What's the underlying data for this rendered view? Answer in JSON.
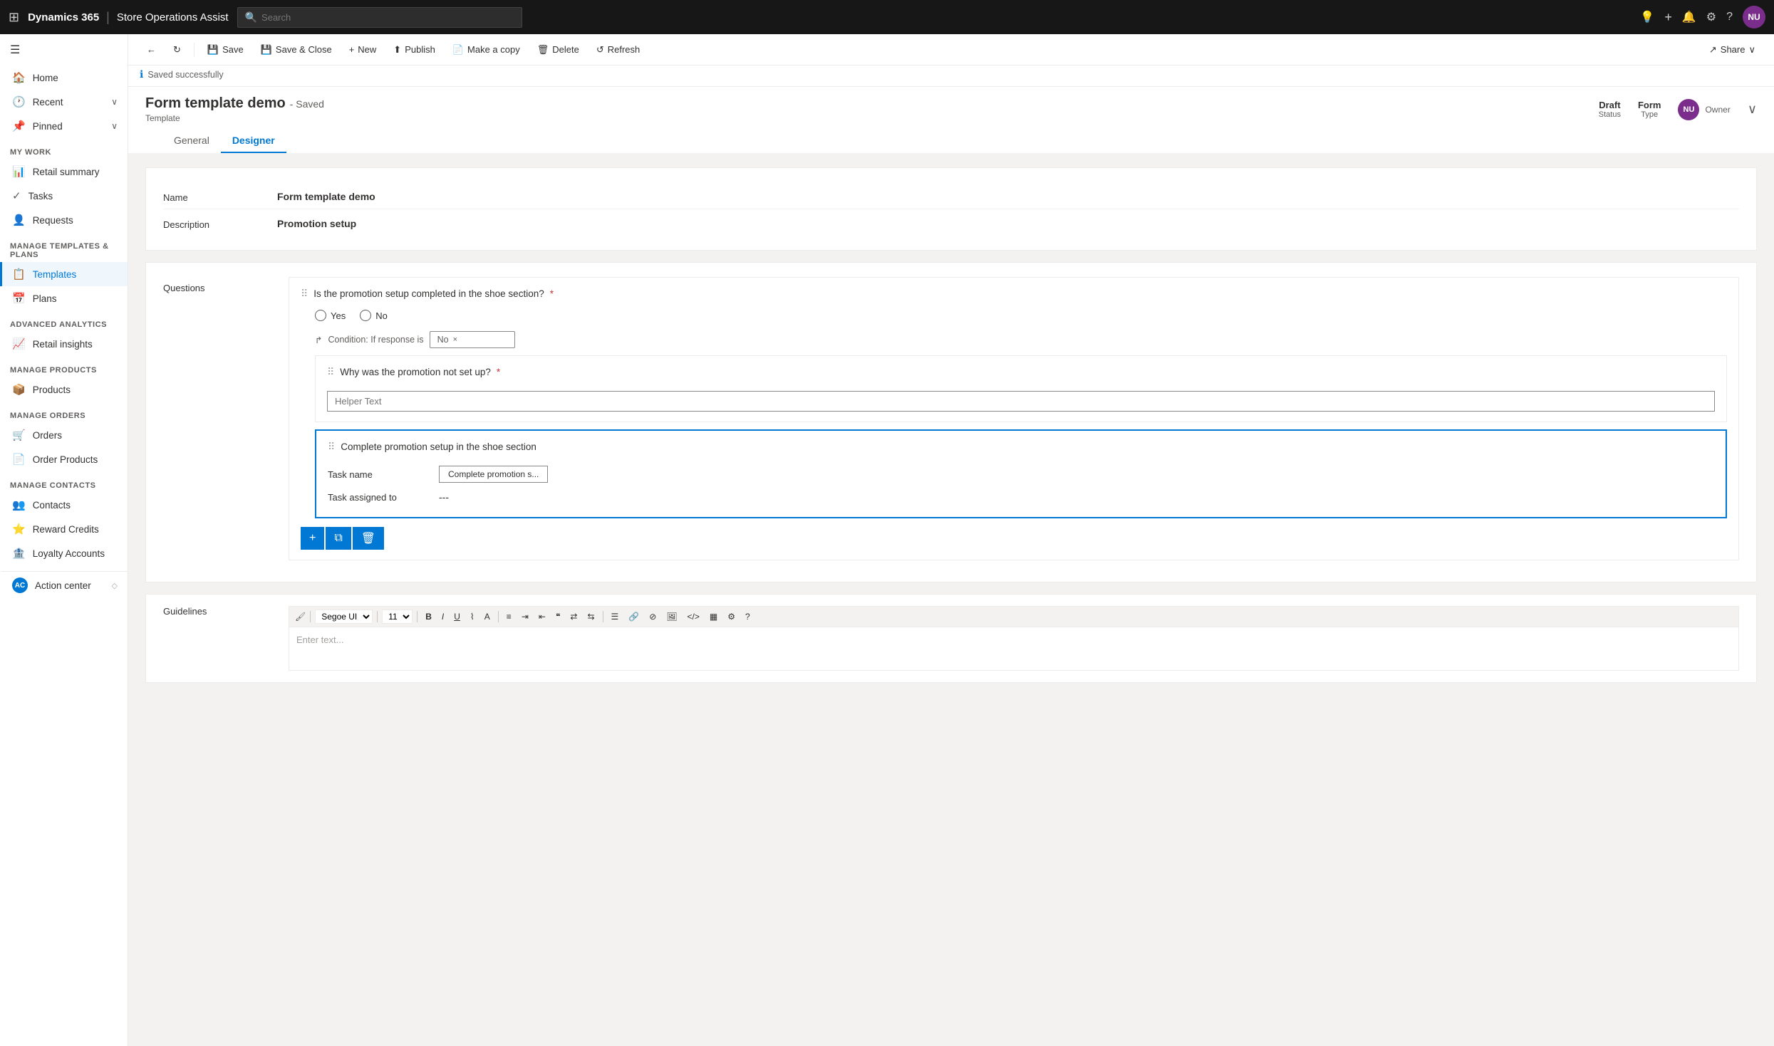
{
  "topnav": {
    "waffle": "⊞",
    "brand": "Dynamics 365",
    "separator": "|",
    "module": "Store Operations Assist",
    "search_placeholder": "Search",
    "icons": {
      "lightbulb": "💡",
      "plus": "+",
      "bell": "🔔",
      "gear": "⚙",
      "help": "?"
    },
    "avatar": "NU"
  },
  "commandbar": {
    "back": "←",
    "refresh_page": "↻",
    "save": "Save",
    "save_close": "Save & Close",
    "new": "New",
    "publish": "Publish",
    "make_copy": "Make a copy",
    "delete": "Delete",
    "refresh": "Refresh",
    "share": "Share"
  },
  "status": {
    "icon": "ℹ",
    "message": "Saved successfully"
  },
  "formheader": {
    "title": "Form template demo",
    "saved_label": "- Saved",
    "subtitle": "Template",
    "status_value": "Draft",
    "status_label": "Status",
    "type_value": "Form",
    "type_label": "Type",
    "owner_label": "Owner",
    "avatar": "NU",
    "expand": "∨"
  },
  "tabs": {
    "general": "General",
    "designer": "Designer"
  },
  "formfields": {
    "name_label": "Name",
    "name_value": "Form template demo",
    "description_label": "Description",
    "description_value": "Promotion setup",
    "questions_label": "Questions"
  },
  "questions": {
    "q1": {
      "drag": "⠿",
      "text": "Is the promotion setup completed in the shoe section?",
      "required": "*",
      "options": [
        "Yes",
        "No"
      ]
    },
    "condition": {
      "icon": "↱",
      "label": "Condition: If response is",
      "value": "No",
      "close": "×"
    },
    "q2": {
      "drag": "⠿",
      "text": "Why was the promotion not set up?",
      "required": "*",
      "placeholder": "Helper Text"
    },
    "task": {
      "drag": "⠿",
      "title": "Complete promotion setup in the shoe section",
      "task_name_label": "Task name",
      "task_name_value": "Complete promotion s...",
      "assigned_label": "Task assigned to",
      "assigned_value": "---"
    }
  },
  "task_actions": {
    "add": "+",
    "copy": "⧉",
    "delete": "🗑"
  },
  "guidelines": {
    "label": "Guidelines",
    "placeholder": "Enter text...",
    "toolbar": {
      "font": "Segoe UI",
      "size": "11",
      "bold": "B",
      "italic": "I",
      "underline": "U",
      "highlight": "⌇",
      "fontcolor": "A",
      "align_left": "≡",
      "indent": "⇥",
      "outdent": "⇤",
      "quote": "❝",
      "rtl": "⇄",
      "ltr": "⇆",
      "bullets": "•",
      "link": "🔗",
      "unlink": "⊘",
      "image": "🖼",
      "code": "</>",
      "table": "▦",
      "settings": "⚙",
      "help": "?"
    }
  },
  "sidebar": {
    "hamburger": "☰",
    "sections": {
      "mywork": "My work",
      "manage_templates": "Manage templates & plans",
      "advanced_analytics": "Advanced analytics",
      "manage_products": "Manage products",
      "manage_orders": "Manage orders",
      "manage_contacts": "Manage contacts"
    },
    "items": [
      {
        "id": "home",
        "icon": "🏠",
        "label": "Home",
        "active": false
      },
      {
        "id": "recent",
        "icon": "🕐",
        "label": "Recent",
        "arrow": "∨",
        "active": false
      },
      {
        "id": "pinned",
        "icon": "📌",
        "label": "Pinned",
        "arrow": "∨",
        "active": false
      },
      {
        "id": "retail-summary",
        "icon": "📊",
        "label": "Retail summary",
        "active": false
      },
      {
        "id": "tasks",
        "icon": "✓",
        "label": "Tasks",
        "active": false
      },
      {
        "id": "requests",
        "icon": "👤",
        "label": "Requests",
        "active": false
      },
      {
        "id": "templates",
        "icon": "📋",
        "label": "Templates",
        "active": true
      },
      {
        "id": "plans",
        "icon": "📅",
        "label": "Plans",
        "active": false
      },
      {
        "id": "retail-insights",
        "icon": "📈",
        "label": "Retail insights",
        "active": false
      },
      {
        "id": "products",
        "icon": "📦",
        "label": "Products",
        "active": false
      },
      {
        "id": "orders",
        "icon": "🛒",
        "label": "Orders",
        "active": false
      },
      {
        "id": "order-products",
        "icon": "📄",
        "label": "Order Products",
        "active": false
      },
      {
        "id": "contacts",
        "icon": "👥",
        "label": "Contacts",
        "active": false
      },
      {
        "id": "reward-credits",
        "icon": "⭐",
        "label": "Reward Credits",
        "active": false
      },
      {
        "id": "loyalty-accounts",
        "icon": "🏦",
        "label": "Loyalty Accounts",
        "active": false
      },
      {
        "id": "action-center",
        "icon": "AC",
        "label": "Action center",
        "active": false
      }
    ]
  }
}
